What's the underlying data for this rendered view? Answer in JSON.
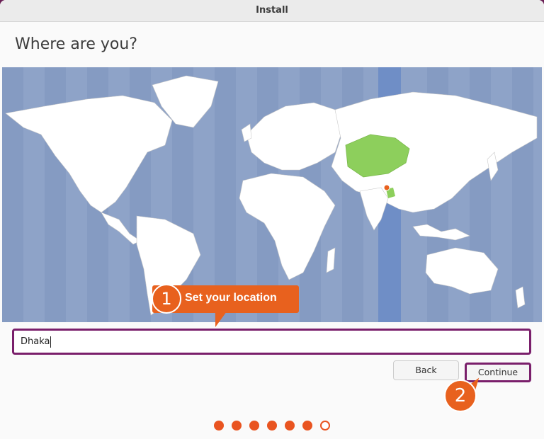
{
  "window": {
    "title": "Install"
  },
  "page": {
    "heading": "Where are you?"
  },
  "map": {
    "selected_city": "Dhaka",
    "highlight_color": "#8dcf5c",
    "timezone_band_color": "#6f8ec6"
  },
  "annotations": {
    "step1_number": "1",
    "step1_text": "Set your location",
    "step2_number": "2",
    "accent": "#e8611e"
  },
  "location_input": {
    "value": "Dhaka"
  },
  "buttons": {
    "back": "Back",
    "continue": "Continue"
  },
  "progress": {
    "total_steps": 7,
    "current_step": 7
  }
}
